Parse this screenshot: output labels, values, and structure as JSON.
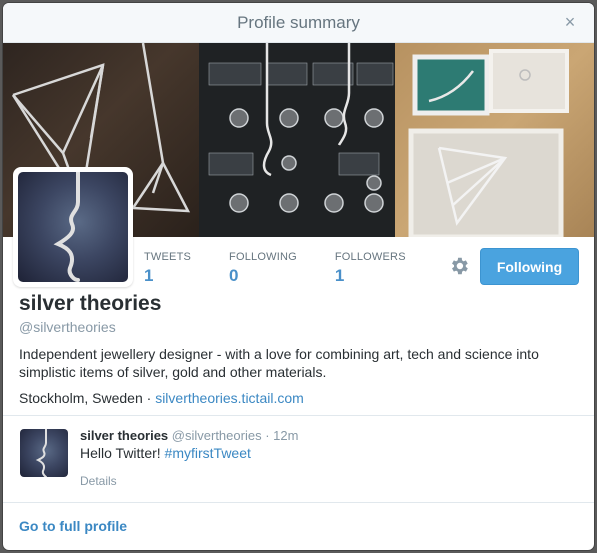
{
  "modal": {
    "title": "Profile summary",
    "close_label": "×"
  },
  "stats": [
    {
      "label": "TWEETS",
      "value": "1"
    },
    {
      "label": "FOLLOWING",
      "value": "0"
    },
    {
      "label": "FOLLOWERS",
      "value": "1"
    }
  ],
  "follow_button": {
    "label": "Following"
  },
  "profile": {
    "name": "silver theories",
    "handle": "@silvertheories",
    "bio": "Independent jewellery designer - with a love for combining art, tech and science into simplistic items of silver, gold and other materials.",
    "location": "Stockholm, Sweden",
    "separator": " · ",
    "website": "silvertheories.tictail.com"
  },
  "tweet": {
    "author_name": "silver theories",
    "author_handle": "@silvertheories",
    "time": "· 12m",
    "text": "Hello Twitter! ",
    "hashtag": "#myfirstTweet",
    "details_label": "Details"
  },
  "footer": {
    "full_profile_label": "Go to full profile"
  },
  "colors": {
    "accent": "#4aa3df",
    "link": "#3b88c3"
  },
  "icons": {
    "close": "close-icon",
    "settings": "gear-icon"
  }
}
